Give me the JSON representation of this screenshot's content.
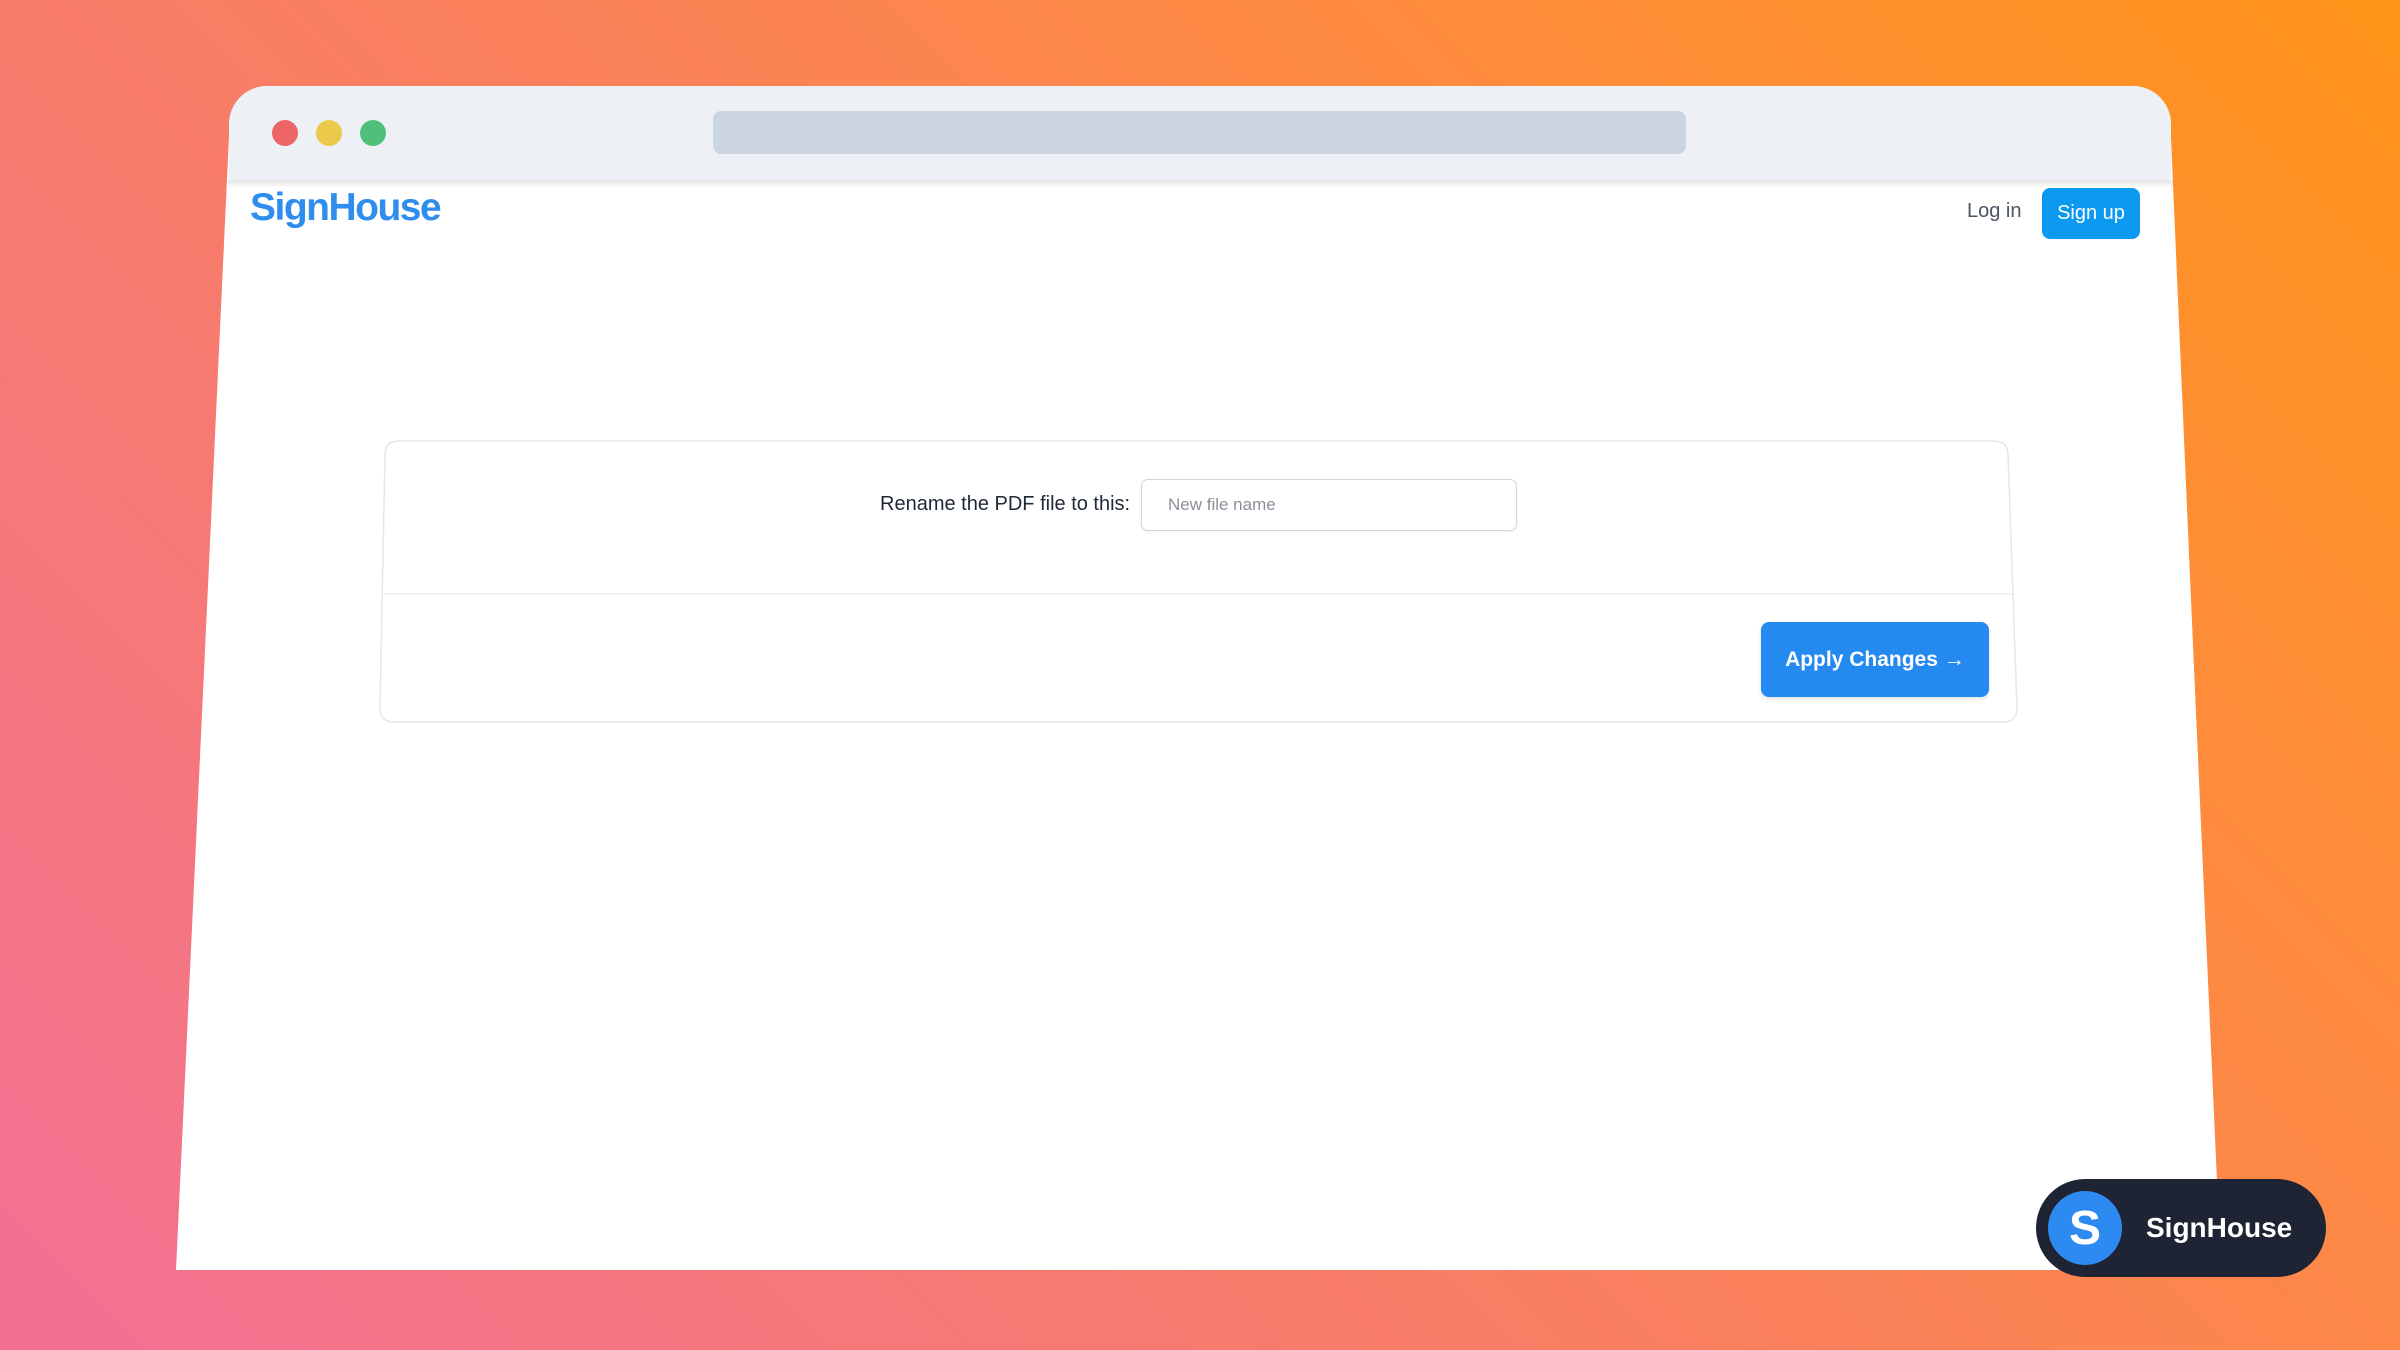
{
  "browser": {
    "traffic_lights": [
      "close",
      "minimize",
      "maximize"
    ]
  },
  "header": {
    "logo": "SignHouse",
    "login_label": "Log in",
    "signup_label": "Sign up"
  },
  "form": {
    "rename_label": "Rename the PDF file to this:",
    "filename_placeholder": "New file name",
    "filename_value": "",
    "apply_label": "Apply Changes",
    "apply_arrow": "→"
  },
  "badge": {
    "letter": "S",
    "name": "SignHouse"
  },
  "colors": {
    "brand": "#2e8ded",
    "signup_bg": "#0c99f0",
    "apply_bg": "#258af0",
    "badge_bg": "#1e2433"
  }
}
